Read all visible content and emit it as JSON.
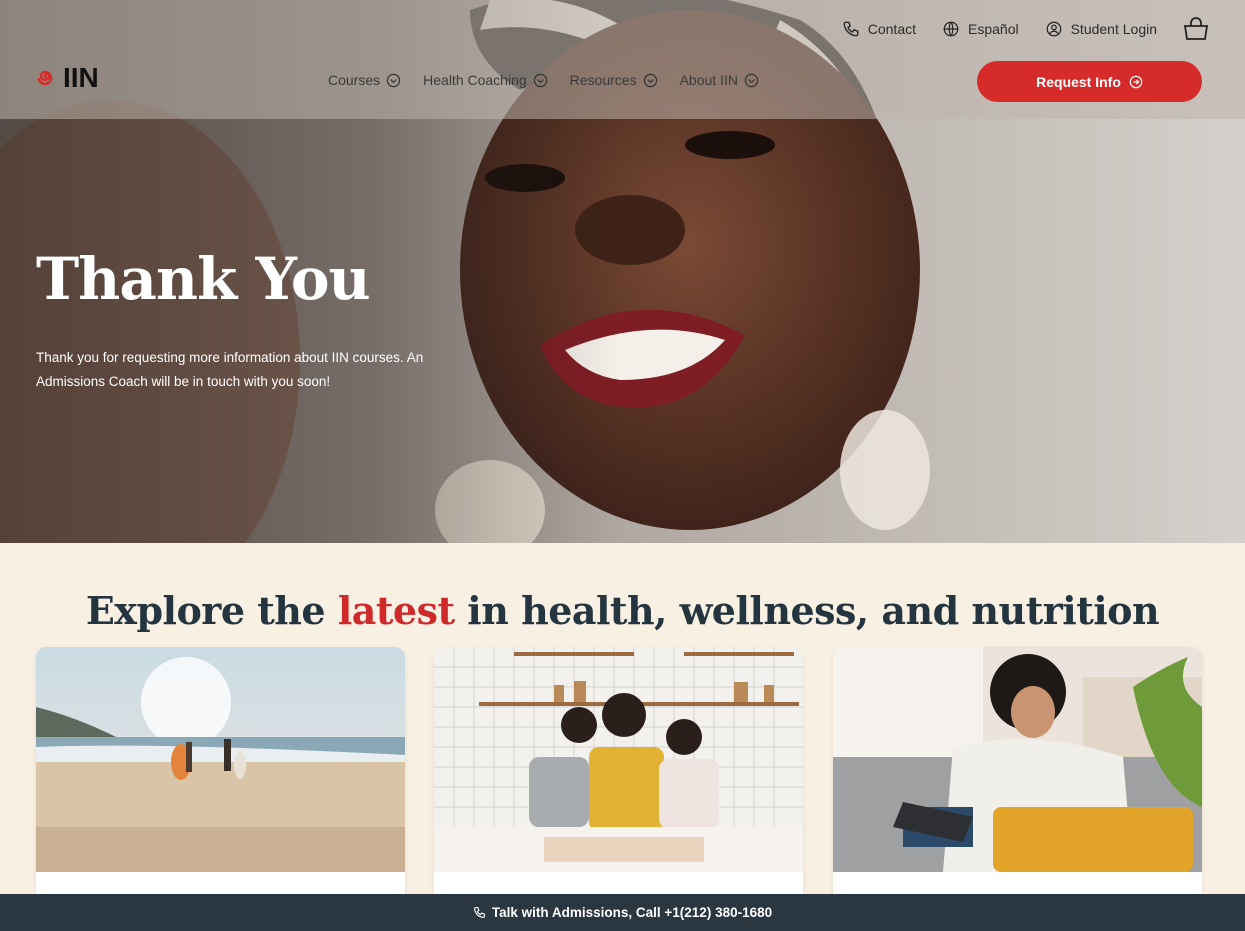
{
  "utility_nav": {
    "contact": "Contact",
    "language": "Español",
    "login": "Student Login"
  },
  "logo": {
    "text": "IIN"
  },
  "main_nav": [
    {
      "label": "Courses"
    },
    {
      "label": "Health Coaching"
    },
    {
      "label": "Resources"
    },
    {
      "label": "About IIN"
    }
  ],
  "cta": {
    "label": "Request Info"
  },
  "hero": {
    "title": "Thank You",
    "text": "Thank you for requesting more information about IIN courses. An Admissions Coach will be in touch with you soon!"
  },
  "explore": {
    "title_before": "Explore the ",
    "title_accent": "latest",
    "title_after": " in health, wellness, and nutrition"
  },
  "bottom_bar": {
    "label": "Talk with Admissions, Call +1(212) 380-1680"
  },
  "colors": {
    "accent": "#d52b2b",
    "dark": "#2a3640",
    "cream": "#f8f0e2"
  },
  "icons": [
    "phone-icon",
    "globe-icon",
    "user-circle-icon",
    "bag-icon",
    "chevron-down-icon",
    "arrow-right-circle-icon"
  ]
}
